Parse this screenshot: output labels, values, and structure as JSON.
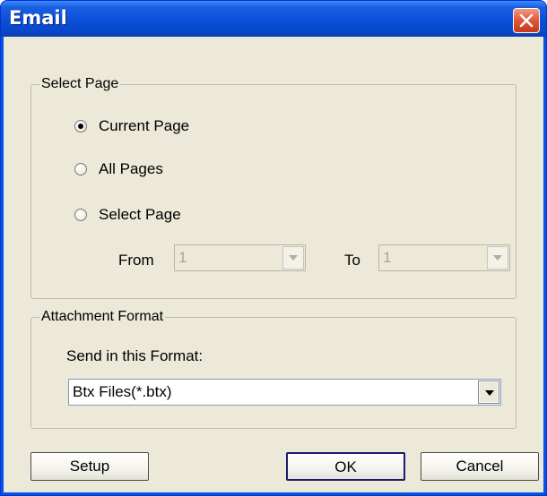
{
  "window": {
    "title": "Email"
  },
  "select_page": {
    "legend": "Select Page",
    "options": [
      {
        "label": "Current Page",
        "selected": true
      },
      {
        "label": "All Pages",
        "selected": false
      },
      {
        "label": "Select Page",
        "selected": false
      }
    ],
    "from_label": "From",
    "from_value": "1",
    "to_label": "To",
    "to_value": "1"
  },
  "attachment": {
    "legend": "Attachment Format",
    "prompt": "Send in this Format:",
    "format_value": "Btx Files(*.btx)"
  },
  "buttons": {
    "setup": "Setup",
    "ok": "OK",
    "cancel": "Cancel"
  }
}
